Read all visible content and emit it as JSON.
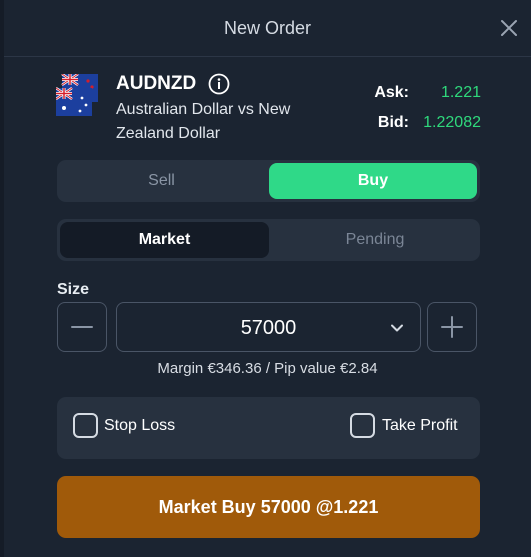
{
  "header": {
    "title": "New Order"
  },
  "instrument": {
    "symbol": "AUDNZD",
    "description": "Australian Dollar vs New Zealand Dollar",
    "ask_label": "Ask:",
    "ask_value": "1.221",
    "bid_label": "Bid:",
    "bid_value": "1.22082"
  },
  "direction_toggle": {
    "sell_label": "Sell",
    "buy_label": "Buy",
    "selected": "Buy"
  },
  "order_type_toggle": {
    "market_label": "Market",
    "pending_label": "Pending",
    "selected": "Market"
  },
  "size": {
    "label": "Size",
    "value": "57000",
    "margin_text": "Margin €346.36 / Pip value €2.84"
  },
  "options": {
    "stop_loss_label": "Stop Loss",
    "take_profit_label": "Take Profit",
    "stop_loss_checked": false,
    "take_profit_checked": false
  },
  "submit": {
    "label": "Market Buy 57000 @1.221"
  },
  "colors": {
    "background": "#1b2431",
    "buy_green": "#2fd988",
    "price_green": "#2fd97c",
    "submit_orange": "#a05a0a",
    "segment_bg": "#27313f"
  },
  "icons": [
    "close-icon",
    "info-icon",
    "chevron-down-icon",
    "minus-icon",
    "plus-icon",
    "flag-icon"
  ]
}
